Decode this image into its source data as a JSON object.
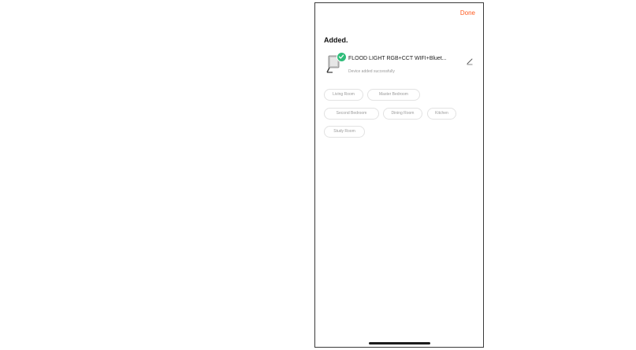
{
  "header": {
    "done_label": "Done"
  },
  "page": {
    "title": "Added."
  },
  "device": {
    "name": "FLOOD LIGHT RGB+CCT WIFI+Bluet...",
    "status": "Device added successfully",
    "image_icon": "flood-light-device-icon",
    "badge_icon": "check-circle-icon",
    "edit_icon": "pencil-icon"
  },
  "rooms": [
    "Living Room",
    "Master Bedroom",
    "Second Bedroom",
    "Dining Room",
    "Kitchen",
    "Study Room"
  ],
  "colors": {
    "accent": "#ff5a1f",
    "success": "#2fbd7a",
    "chip_border": "#e2e2e2",
    "chip_text": "#9a9a9a"
  }
}
